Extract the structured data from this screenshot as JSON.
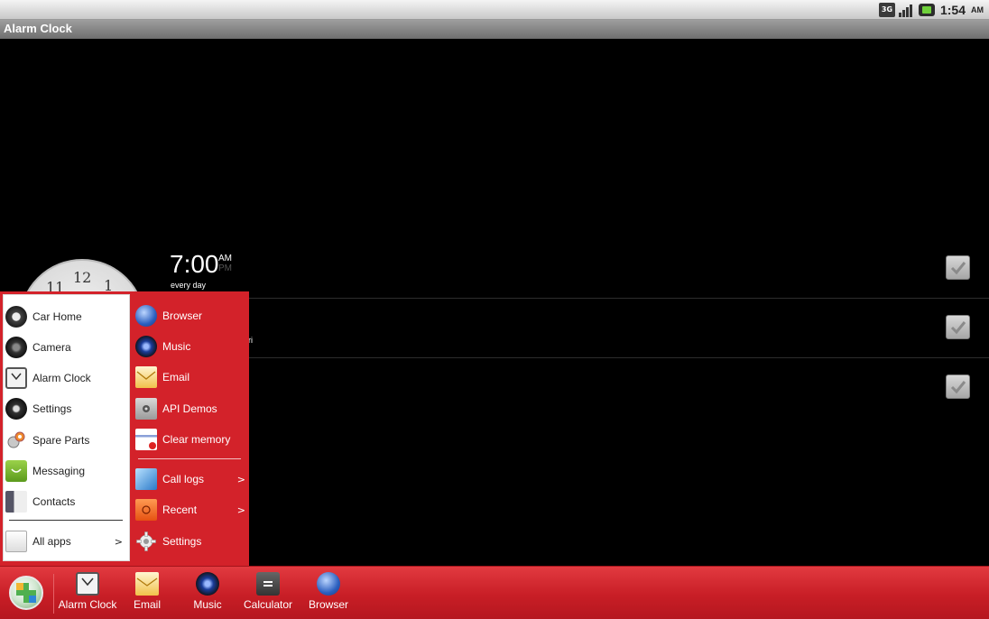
{
  "status_bar": {
    "network": "3G",
    "time": "1:54",
    "ampm": "AM"
  },
  "title_bar": {
    "title": "Alarm Clock"
  },
  "clock_face": {
    "numbers": [
      "12",
      "11",
      "1"
    ]
  },
  "alarms": [
    {
      "time": "7:00",
      "am": "AM",
      "pm": "PM",
      "repeat": "every day",
      "checked": true
    },
    {
      "time": "",
      "repeat_tail": "ri",
      "checked": true
    },
    {
      "time": "",
      "checked": true
    }
  ],
  "start_menu": {
    "left_items": [
      {
        "label": "Car Home",
        "icon": "car-home-icon"
      },
      {
        "label": "Camera",
        "icon": "camera-icon"
      },
      {
        "label": "Alarm Clock",
        "icon": "alarm-clock-icon"
      },
      {
        "label": "Settings",
        "icon": "settings-icon"
      },
      {
        "label": "Spare Parts",
        "icon": "spare-parts-icon"
      },
      {
        "label": "Messaging",
        "icon": "messaging-icon"
      },
      {
        "label": "Contacts",
        "icon": "contacts-icon"
      }
    ],
    "all_apps": {
      "label": "All apps",
      "arrow": ">",
      "icon": "all-apps-icon"
    },
    "right_items": [
      {
        "label": "Browser",
        "icon": "globe-icon"
      },
      {
        "label": "Music",
        "icon": "speaker-icon"
      },
      {
        "label": "Email",
        "icon": "email-icon"
      },
      {
        "label": "API Demos",
        "icon": "folder-gear-icon"
      },
      {
        "label": "Clear memory",
        "icon": "clear-memory-icon"
      }
    ],
    "right_submenus": [
      {
        "label": "Call logs",
        "arrow": ">",
        "icon": "call-logs-icon"
      },
      {
        "label": "Recent",
        "arrow": ">",
        "icon": "recent-folder-icon"
      },
      {
        "label": "Settings",
        "arrow": "",
        "icon": "gear-icon"
      }
    ]
  },
  "taskbar": {
    "apps": [
      {
        "label": "Alarm Clock",
        "icon": "alarm-clock-icon"
      },
      {
        "label": "Email",
        "icon": "email-icon"
      },
      {
        "label": "Music",
        "icon": "speaker-icon"
      },
      {
        "label": "Calculator",
        "icon": "calculator-icon"
      },
      {
        "label": "Browser",
        "icon": "globe-icon"
      }
    ]
  },
  "colors": {
    "menu_red": "#d3222a",
    "taskbar_red": "#c81e26"
  }
}
